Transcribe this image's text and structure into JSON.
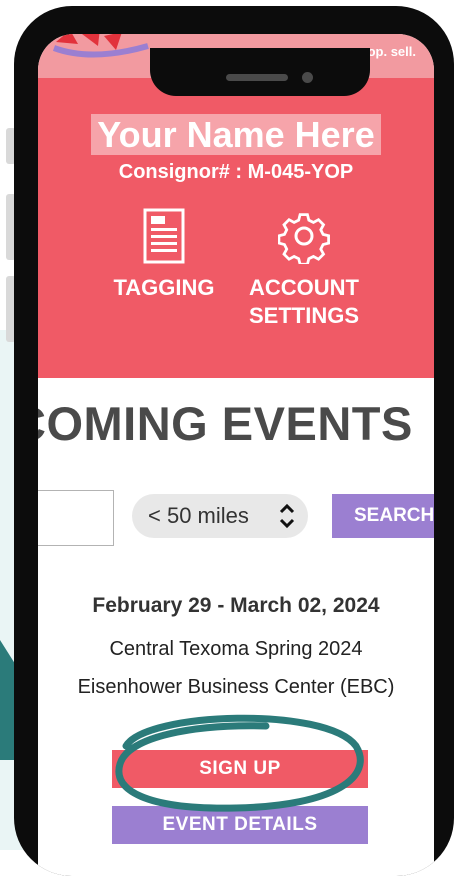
{
  "banner": {
    "tagline": "op. sell."
  },
  "profile": {
    "name": "Your Name Here",
    "consignor": "Consignor# : M-045-YOP"
  },
  "nav": [
    {
      "label": "TAGGING",
      "icon": "tag-sheet-icon"
    },
    {
      "label": "ACCOUNT SETTINGS",
      "icon": "gear-icon"
    }
  ],
  "events": {
    "title": "COMING EVENTS",
    "zip_value": "",
    "distance_selected": "< 50 miles",
    "search_label": "SEARCH",
    "date": "February 29 - March 02, 2024",
    "name": "Central Texoma Spring 2024",
    "venue": "Eisenhower Business Center (EBC)",
    "signup_label": "SIGN UP",
    "details_label": "EVENT DETAILS"
  },
  "colors": {
    "header": "#f05a66",
    "purple": "#9b7fd1",
    "teal": "#2b7b7a",
    "banner": "#f29aa0"
  }
}
